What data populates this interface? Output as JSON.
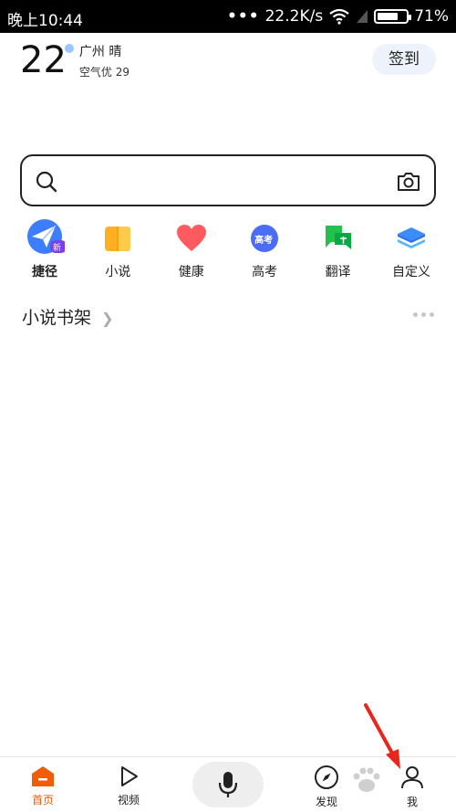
{
  "status_bar": {
    "time": "晚上10:44",
    "network_speed": "22.2K/s",
    "battery_percent": "71%",
    "battery_level": 0.71
  },
  "weather": {
    "temperature": "22",
    "city_condition": "广州 晴",
    "air_quality": "空气优 29"
  },
  "header": {
    "signin_label": "签到"
  },
  "search": {
    "placeholder": "",
    "icons": [
      "search-icon",
      "camera-icon"
    ]
  },
  "shortcuts": [
    {
      "label": "捷径",
      "badge": "新",
      "icon": "paper-plane-icon"
    },
    {
      "label": "小说",
      "icon": "book-icon"
    },
    {
      "label": "健康",
      "icon": "heart-icon"
    },
    {
      "label": "高考",
      "badge": "高考",
      "icon": "gaokao-icon"
    },
    {
      "label": "翻译",
      "icon": "translate-icon"
    },
    {
      "label": "自定义",
      "icon": "layers-icon"
    }
  ],
  "shelf": {
    "title": "小说书架"
  },
  "tabbar": {
    "home": "首页",
    "video": "视频",
    "discover": "发现",
    "me": "我"
  },
  "colors": {
    "accent": "#f25c05",
    "search_border": "#222222",
    "signin_bg": "#eef2fb",
    "arrow": "#e8261e"
  }
}
